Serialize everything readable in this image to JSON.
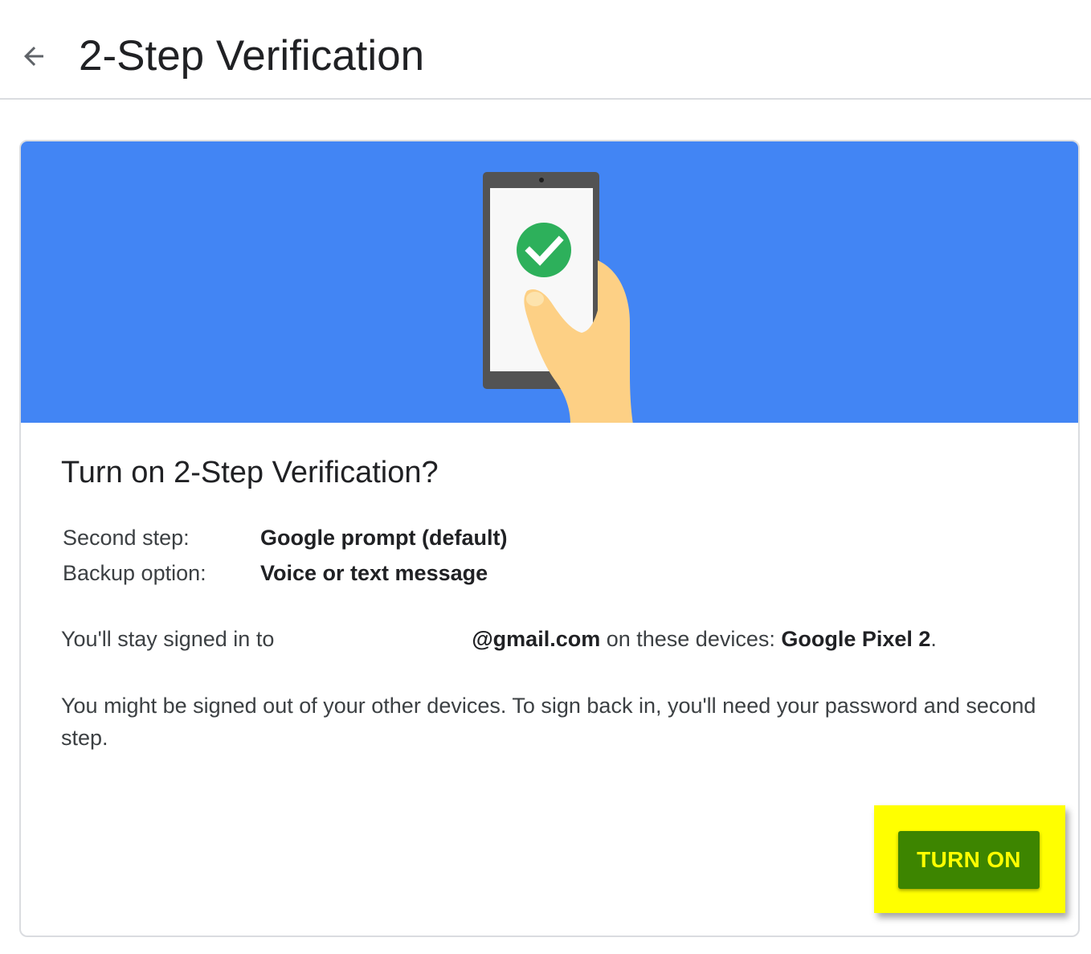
{
  "header": {
    "back_icon": "arrow-back-icon",
    "title": "2-Step Verification"
  },
  "banner": {
    "illustration": "phone-in-hand-with-check-icon",
    "colors": {
      "background": "#4285f4",
      "check_circle": "#2db05b",
      "hand": "#fdd085"
    }
  },
  "card": {
    "title": "Turn on 2-Step Verification?",
    "details": [
      {
        "label": "Second step:",
        "value": "Google prompt (default)"
      },
      {
        "label": "Backup option:",
        "value": "Voice or text message"
      }
    ],
    "signed_in": {
      "prefix": "You'll stay signed in to",
      "email": "@gmail.com",
      "middle": " on these devices: ",
      "device": "Google Pixel 2",
      "suffix": "."
    },
    "signout_note": "You might be signed out of your other devices. To sign back in, you'll need your password and second step."
  },
  "actions": {
    "turn_on_label": "TURN ON",
    "highlight_color": "#ffff00",
    "button_color": "#3d8500"
  }
}
